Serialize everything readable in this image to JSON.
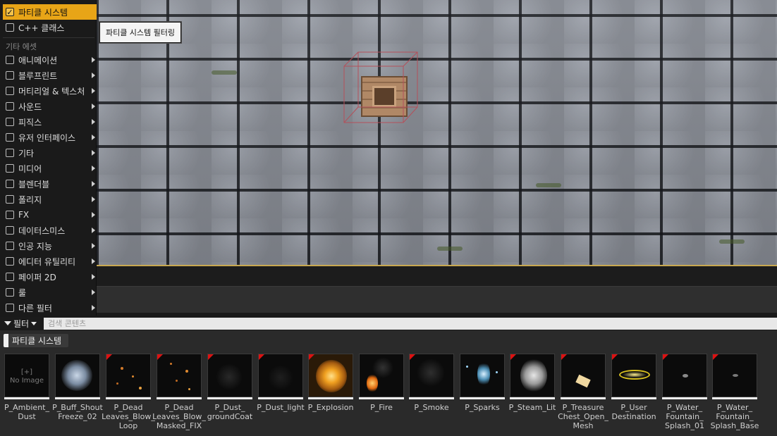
{
  "filter_menu": {
    "items": [
      {
        "label": "파티클 시스템",
        "checked": true,
        "has_submenu": false
      },
      {
        "label": "C++ 클래스",
        "checked": false,
        "has_submenu": false
      }
    ],
    "other_assets_header": "기타 에셋",
    "categories": [
      {
        "label": "애니메이션"
      },
      {
        "label": "블루프린트"
      },
      {
        "label": "머티리얼 & 텍스처"
      },
      {
        "label": "사운드"
      },
      {
        "label": "피직스"
      },
      {
        "label": "유저 인터페이스"
      },
      {
        "label": "기타"
      },
      {
        "label": "미디어"
      },
      {
        "label": "블렌더블"
      },
      {
        "label": "폴리지"
      },
      {
        "label": "FX"
      },
      {
        "label": "데이터스미스"
      },
      {
        "label": "인공 지능"
      },
      {
        "label": "에디터 유틸리티"
      },
      {
        "label": "페이퍼 2D"
      },
      {
        "label": "룰"
      },
      {
        "label": "다른 필터"
      }
    ],
    "checkmark": "✓"
  },
  "tooltip": {
    "text": "파티클 시스템 필터링"
  },
  "toolbar": {
    "filter_label": "필터",
    "search_placeholder": "검색 콘텐츠"
  },
  "active_filter": {
    "label": "파티클 시스템"
  },
  "assets": [
    {
      "name": "P_Ambient_\nDust",
      "thumb": "noimage",
      "thumb_text": "[+]\nNo Image",
      "red_corner": false
    },
    {
      "name": "P_Buff_Shout\nFreeze_02",
      "thumb": "ice",
      "red_corner": false
    },
    {
      "name": "P_Dead\nLeaves_Blow_\nLoop",
      "thumb": "leaves",
      "red_corner": true
    },
    {
      "name": "P_Dead\nLeaves_Blow_\nMasked_FIX",
      "thumb": "leaves",
      "red_corner": true
    },
    {
      "name": "P_Dust_\ngroundCoat",
      "thumb": "dark",
      "red_corner": true
    },
    {
      "name": "P_Dust_light",
      "thumb": "dark",
      "red_corner": true
    },
    {
      "name": "P_Explosion",
      "thumb": "explosion",
      "red_corner": true
    },
    {
      "name": "P_Fire",
      "thumb": "fire",
      "red_corner": false
    },
    {
      "name": "P_Smoke",
      "thumb": "smoke",
      "red_corner": true
    },
    {
      "name": "P_Sparks",
      "thumb": "sparks",
      "red_corner": false
    },
    {
      "name": "P_Steam_Lit",
      "thumb": "steam",
      "red_corner": true
    },
    {
      "name": "P_Treasure\nChest_Open_\nMesh",
      "thumb": "chest",
      "red_corner": true
    },
    {
      "name": "P_User\nDestination",
      "thumb": "destination",
      "red_corner": true
    },
    {
      "name": "P_Water_\nFountain_\nSplash_01",
      "thumb": "water",
      "red_corner": true
    },
    {
      "name": "P_Water_\nFountain_\nSplash_Base",
      "thumb": "water",
      "red_corner": true
    }
  ],
  "colors": {
    "selection_accent": "#e8a517",
    "unsupported_marker": "#dd1111"
  }
}
